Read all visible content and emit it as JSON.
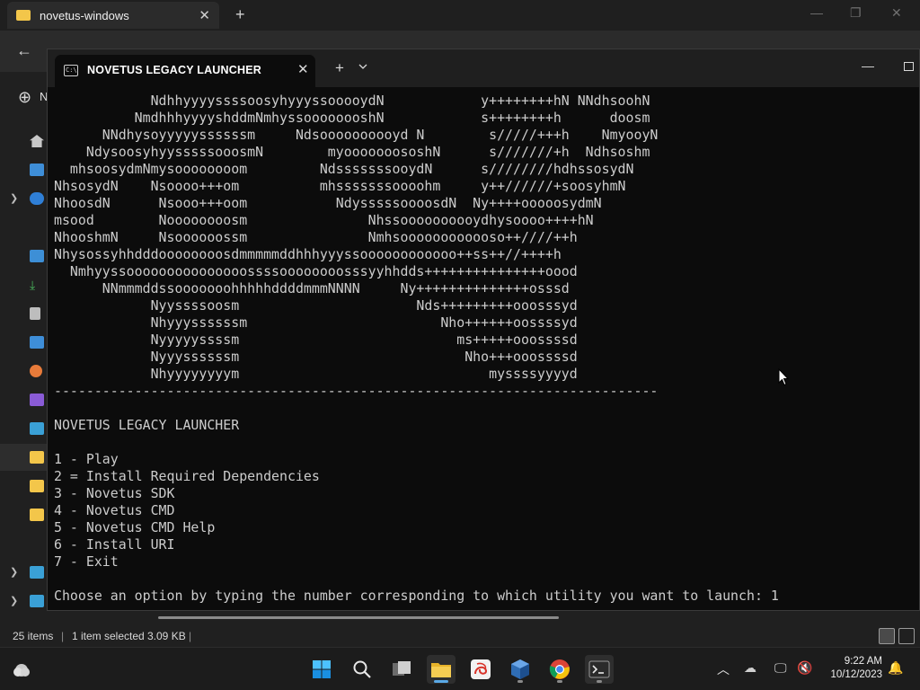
{
  "explorer": {
    "tab_title": "novetus-windows",
    "new_label": "N",
    "status": {
      "items": "25 items",
      "selected": "1 item selected",
      "size": "3.09 KB"
    }
  },
  "terminal": {
    "tab_title": "NOVETUS LEGACY LAUNCHER",
    "lines": [
      "            NdhhyyyyssssoosyhyyyssooooydN            y++++++++hN NNdhsoohN",
      "          NmdhhhyyyyshddmNmhyssoooooooshN            s++++++++h      doosm",
      "      NNdhysoyyyyyssssssm     Ndsoooooooooyd N        s/////+++h    NmyooyN",
      "    NdysoosyhyysssssooosmN        myooooooososhN      s///////+h  Ndhsoshm",
      "  mhsoosydmNmysoooooooom         NdsssssssooydN      s////////hdhssosydN",
      "NhsosydN    Nsoooo+++om          mhsssssssoooohm     y++//////+soosyhmN",
      "NhoosdN      Nsooo+++oom           NdysssssoooosdN  Ny++++ooooosydmN",
      "msood        Noooooooosm               Nhssoooooooooydhysoooo++++hN",
      "NhooshmN     Nsoooooossm               Nmhsoooooooooooso++////++h",
      "Nhysossyhhdddoooooooosdmmmmmddhhhyyyssoooooooooooo++ss++//++++h",
      "  Nmhyyssooooooooooooooossssoooooooosssyyhhdds+++++++++++++++oood",
      "      NNmmmddssooooooohhhhhddddmmmNNNN     Ny++++++++++++++osssd",
      "            Nyyssssoosm                      Nds+++++++++ooosssyd",
      "            Nhyyyssssssm                        Nho++++++oossssyd",
      "            Nyyyyyssssm                           ms+++++ooossssd",
      "            Nyyyssssssm                            Nho+++ooossssd",
      "            Nhyyyyyyyym                               myssssyyyyd",
      "---------------------------------------------------------------------------",
      "",
      "NOVETUS LEGACY LAUNCHER",
      "",
      "1 - Play",
      "2 = Install Required Dependencies",
      "3 - Novetus SDK",
      "4 - Novetus CMD",
      "5 - Novetus CMD Help",
      "6 - Install URI",
      "7 - Exit",
      "",
      "Choose an option by typing the number corresponding to which utility you want to launch: 1"
    ]
  },
  "taskbar": {
    "time": "9:22 AM",
    "date": "10/12/2023"
  },
  "colors": {
    "terminal_bg": "#0c0c0c",
    "terminal_fg": "#cccccc",
    "accent": "#5aa9e6"
  }
}
